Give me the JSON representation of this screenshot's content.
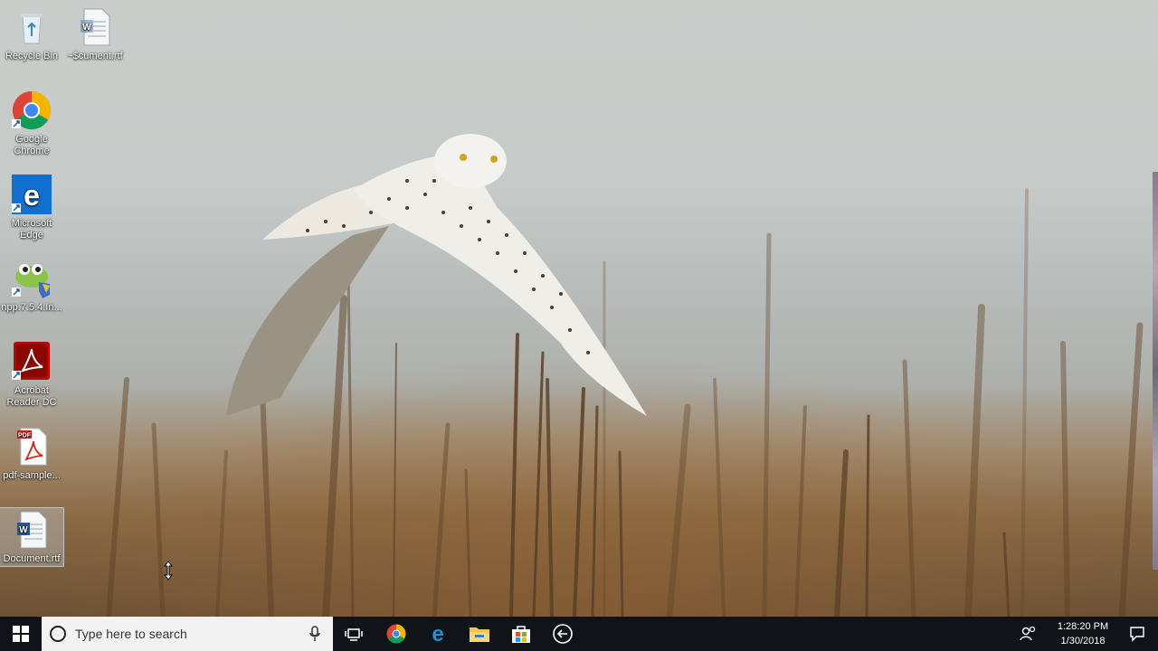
{
  "desktop_icons": [
    {
      "label": "Recycle Bin",
      "icon": "recycle-bin-icon"
    },
    {
      "label": "~$cument.rtf",
      "icon": "word-document-icon"
    },
    {
      "label": "Google Chrome",
      "icon": "chrome-icon"
    },
    {
      "label": "Microsoft Edge",
      "icon": "edge-icon"
    },
    {
      "label": "npp.7.5.4.In...",
      "icon": "notepad-plus-plus-icon"
    },
    {
      "label": "Acrobat Reader DC",
      "icon": "acrobat-reader-icon"
    },
    {
      "label": "pdf-sample...",
      "icon": "pdf-file-icon"
    },
    {
      "label": "Document.rtf",
      "icon": "word-document-icon"
    }
  ],
  "taskbar": {
    "search_placeholder": "Type here to search",
    "pinned": [
      "task-view-icon",
      "chrome-icon",
      "edge-icon",
      "file-explorer-icon",
      "store-icon",
      "back-arrow-icon"
    ],
    "time": "1:28:20 PM",
    "date": "1/30/2018"
  },
  "colors": {
    "taskbar": "#101418",
    "search_box": "#f2f2f2",
    "accent": "#1e90d6"
  }
}
